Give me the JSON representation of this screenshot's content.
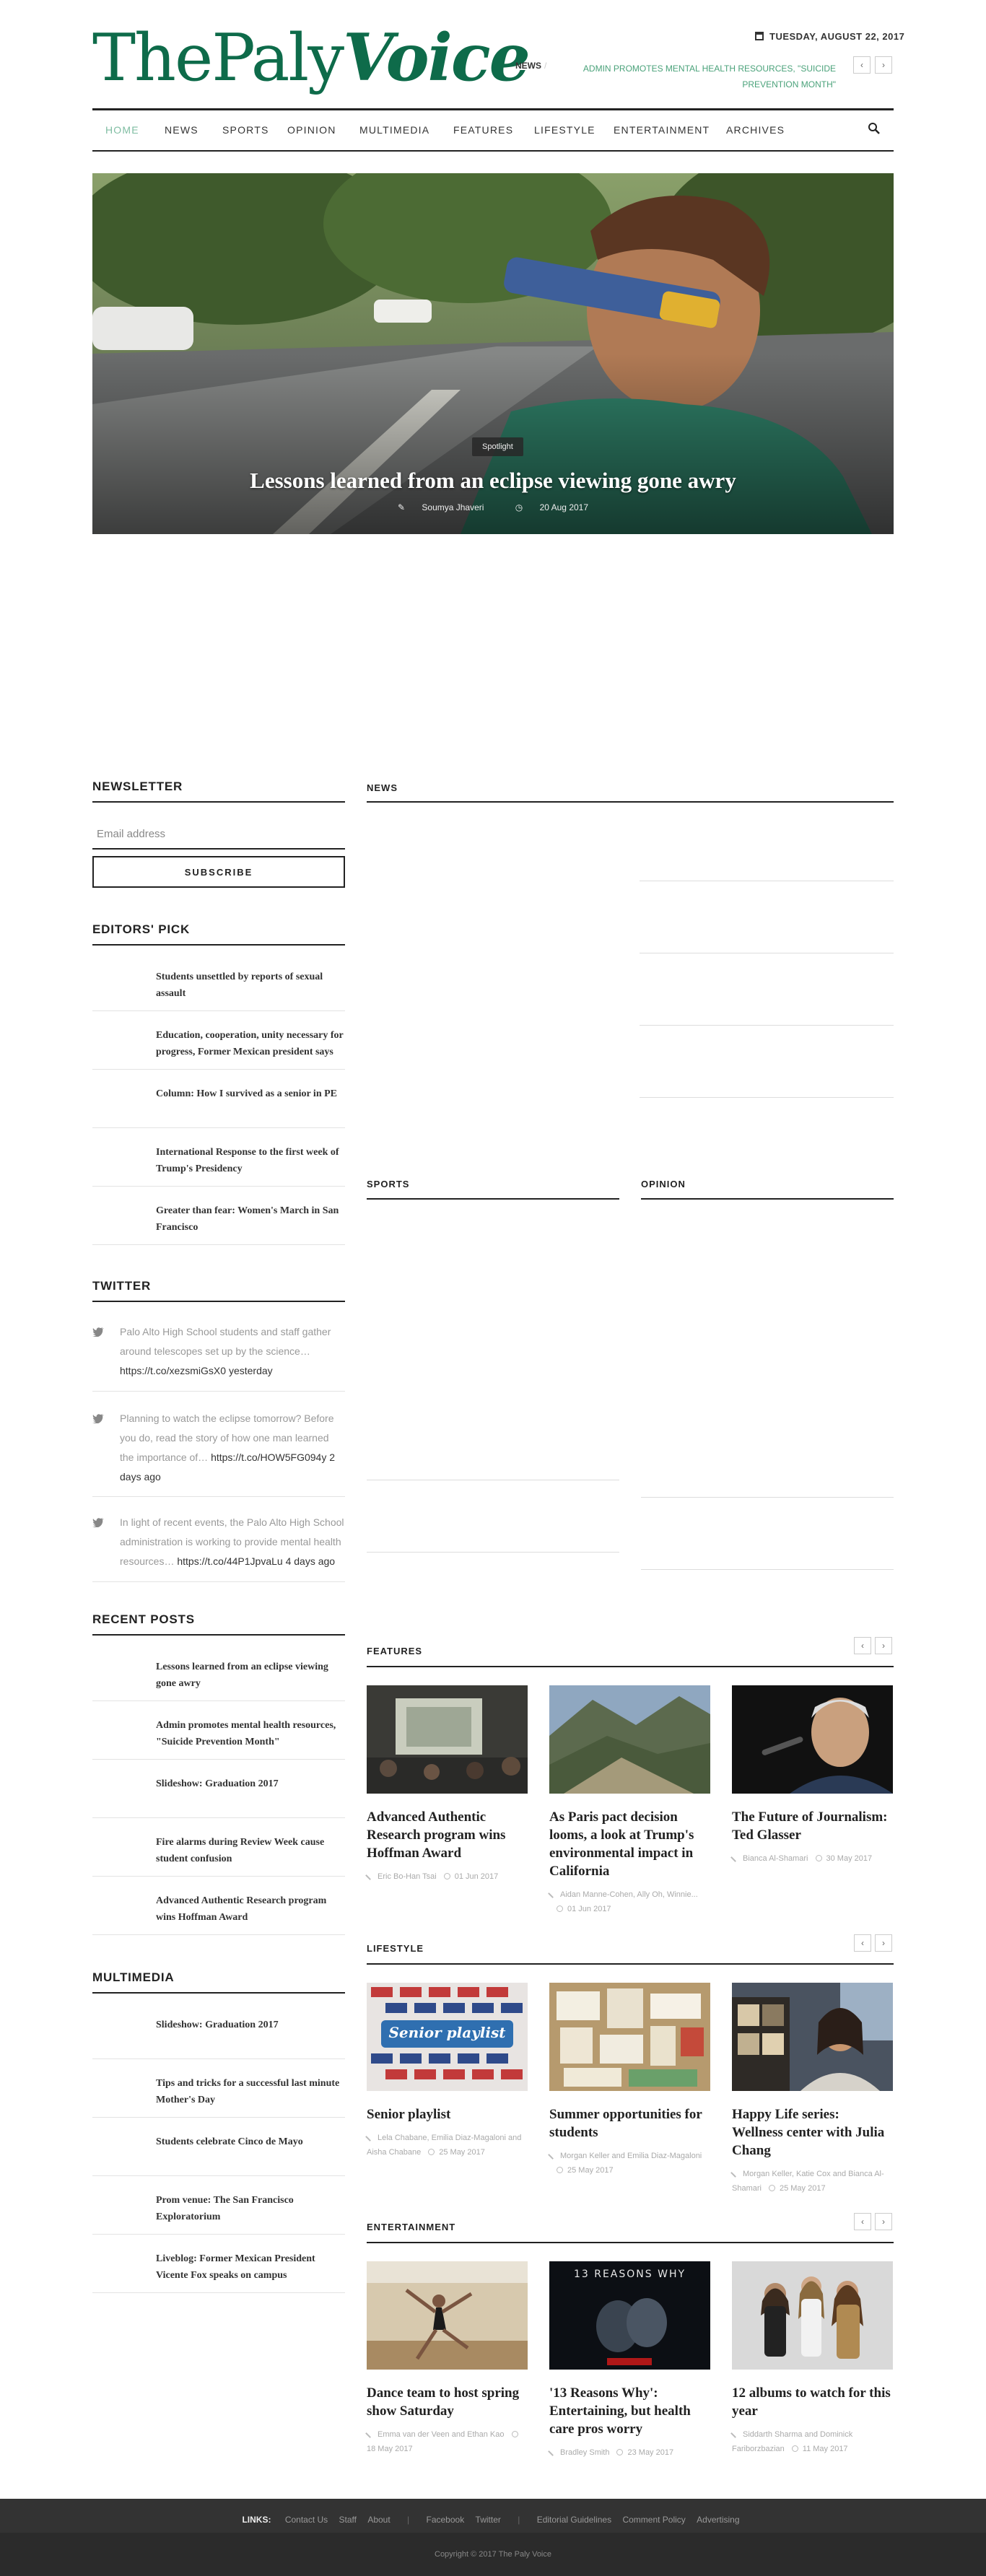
{
  "header": {
    "logo_main": "ThePaly",
    "logo_italic": "Voice",
    "date": "TUESDAY, AUGUST 22, 2017",
    "ticker_label": "NEWS",
    "ticker_text": "ADMIN PROMOTES MENTAL HEALTH RESOURCES, \"SUICIDE PREVENTION MONTH\"",
    "ticker_prev": "‹",
    "ticker_next": "›"
  },
  "nav": {
    "items": [
      "HOME",
      "NEWS",
      "SPORTS",
      "OPINION",
      "MULTIMEDIA",
      "FEATURES",
      "LIFESTYLE",
      "ENTERTAINMENT",
      "ARCHIVES"
    ],
    "active": "HOME"
  },
  "hero": {
    "tag": "Spotlight",
    "title": "Lessons learned from an eclipse viewing gone awry",
    "author": "Soumya Jhaveri",
    "date": "20 Aug 2017"
  },
  "newsletter": {
    "title": "NEWSLETTER",
    "placeholder": "Email address",
    "button": "SUBSCRIBE"
  },
  "editors_pick": {
    "title": "EDITORS' PICK",
    "items": [
      "Students unsettled by reports of sexual assault",
      "Education, cooperation, unity necessary for progress, Former Mexican president says",
      "Column: How I survived as a senior in PE",
      "International Response to the first week of Trump's Presidency",
      "Greater than fear: Women's March in San Francisco"
    ]
  },
  "twitter": {
    "title": "TWITTER",
    "tweets": [
      {
        "text": "Palo Alto High School students and staff gather around telescopes set up by the science…",
        "link": "https://t.co/xezsmiGsX0",
        "time": "yesterday"
      },
      {
        "text": "Planning to watch the eclipse tomorrow? Before you do, read the story of how one man learned the importance of…",
        "link": "https://t.co/HOW5FG094y",
        "time": "2 days ago"
      },
      {
        "text": "In light of recent events, the Palo Alto High School administration is working to provide mental health resources…",
        "link": "https://t.co/44P1JpvaLu",
        "time": "4 days ago"
      }
    ]
  },
  "recent_posts": {
    "title": "RECENT POSTS",
    "items": [
      "Lessons learned from an eclipse viewing gone awry",
      "Admin promotes mental health resources, \"Suicide Prevention Month\"",
      "Slideshow: Graduation 2017",
      "Fire alarms during Review Week cause student confusion",
      "Advanced Authentic Research program wins Hoffman Award"
    ]
  },
  "multimedia": {
    "title": "MULTIMEDIA",
    "items": [
      "Slideshow: Graduation 2017",
      "Tips and tricks for a successful last minute Mother's Day",
      "Students celebrate Cinco de Mayo",
      "Prom venue: The San Francisco Exploratorium",
      "Liveblog: Former Mexican President Vicente Fox speaks on campus"
    ]
  },
  "sections": {
    "news": "NEWS",
    "sports": "SPORTS",
    "opinion": "OPINION",
    "features": "FEATURES",
    "lifestyle": "LIFESTYLE",
    "entertainment": "ENTERTAINMENT"
  },
  "features": [
    {
      "title": "Advanced Authentic Research program wins Hoffman Award",
      "authors": "Eric Bo-Han Tsai",
      "date": "01 Jun 2017"
    },
    {
      "title": "As Paris pact decision looms, a look at Trump's environmental impact in California",
      "authors": "Aidan Manne-Cohen, Ally Oh, Winnie...",
      "date": "01 Jun 2017"
    },
    {
      "title": "The Future of Journalism: Ted Glasser",
      "authors": "Bianca Al-Shamari",
      "date": "30 May 2017"
    }
  ],
  "lifestyle": [
    {
      "title": "Senior playlist",
      "authors": "Lela Chabane, Emilia Diaz-Magaloni and Aisha Chabane",
      "date": "25 May 2017",
      "img_text": "Senior playlist"
    },
    {
      "title": "Summer opportunities for students",
      "authors": "Morgan Keller and Emilia Diaz-Magaloni",
      "date": "25 May 2017"
    },
    {
      "title": "Happy Life series: Wellness center with Julia Chang",
      "authors": "Morgan Keller, Katie Cox and Bianca Al-Shamari",
      "date": "25 May 2017"
    }
  ],
  "entertainment": [
    {
      "title": "Dance team to host spring show Saturday",
      "authors": "Emma van der Veen and Ethan Kao",
      "date": "18 May 2017"
    },
    {
      "title": "'13 Reasons Why': Entertaining, but health care pros worry",
      "authors": "Bradley Smith",
      "date": "23 May 2017",
      "img_text": "13 REASONS WHY"
    },
    {
      "title": "12 albums to watch for this year",
      "authors": "Siddarth Sharma and Dominick Fariborzbazian",
      "date": "11 May 2017"
    }
  ],
  "footer": {
    "links_label": "LINKS:",
    "group1": [
      "Contact Us",
      "Staff",
      "About"
    ],
    "group2": [
      "Facebook",
      "Twitter"
    ],
    "group3": [
      "Editorial Guidelines",
      "Comment Policy",
      "Advertising"
    ],
    "copyright": "Copyright © 2017 The Paly Voice"
  },
  "colors": {
    "brand_green": "#0e6b4a",
    "link_green": "#4aa27a",
    "footer": "#333333"
  }
}
